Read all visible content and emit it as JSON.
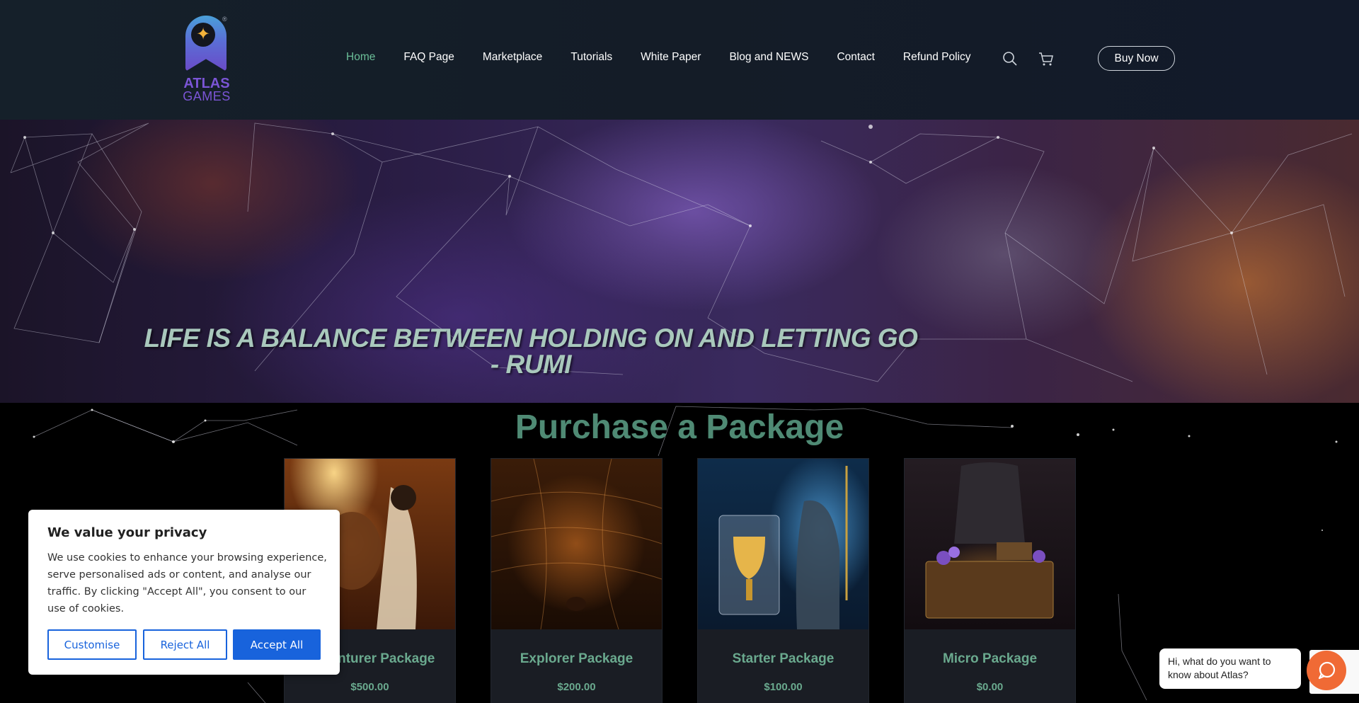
{
  "header": {
    "logo": {
      "line1": "ATLAS",
      "line2": "GAMES",
      "reg": "®"
    },
    "nav": [
      {
        "label": "Home",
        "active": true
      },
      {
        "label": "FAQ Page"
      },
      {
        "label": "Marketplace"
      },
      {
        "label": "Tutorials"
      },
      {
        "label": "White Paper"
      },
      {
        "label": "Blog and NEWS"
      },
      {
        "label": "Contact"
      },
      {
        "label": "Refund Policy"
      }
    ],
    "icons": [
      "search-icon",
      "cart-icon"
    ],
    "buy_now": "Buy Now"
  },
  "hero": {
    "quote": "LIFE IS A BALANCE BETWEEN HOLDING ON AND LETTING GO - RUMI"
  },
  "purchase": {
    "title": "Purchase a Package",
    "packages": [
      {
        "title": "Adventurer Package",
        "price": "$500.00"
      },
      {
        "title": "Explorer Package",
        "price": "$200.00"
      },
      {
        "title": "Starter Package",
        "price": "$100.00"
      },
      {
        "title": "Micro Package",
        "price": "$0.00"
      }
    ]
  },
  "cookie": {
    "title": "We value your privacy",
    "text": "We use cookies to enhance your browsing experience, serve personalised ads or content, and analyse our traffic. By clicking \"Accept All\", you consent to our use of cookies.",
    "customise": "Customise",
    "reject": "Reject All",
    "accept": "Accept All"
  },
  "chat": {
    "message": "Hi, what do you want to know about Atlas?"
  },
  "colors": {
    "accent_green": "#6bbf98",
    "title_green": "#4f8a74",
    "cookie_blue": "#1863dc",
    "chat_orange": "#f06a35",
    "logo_purple": "#7b55d6"
  }
}
